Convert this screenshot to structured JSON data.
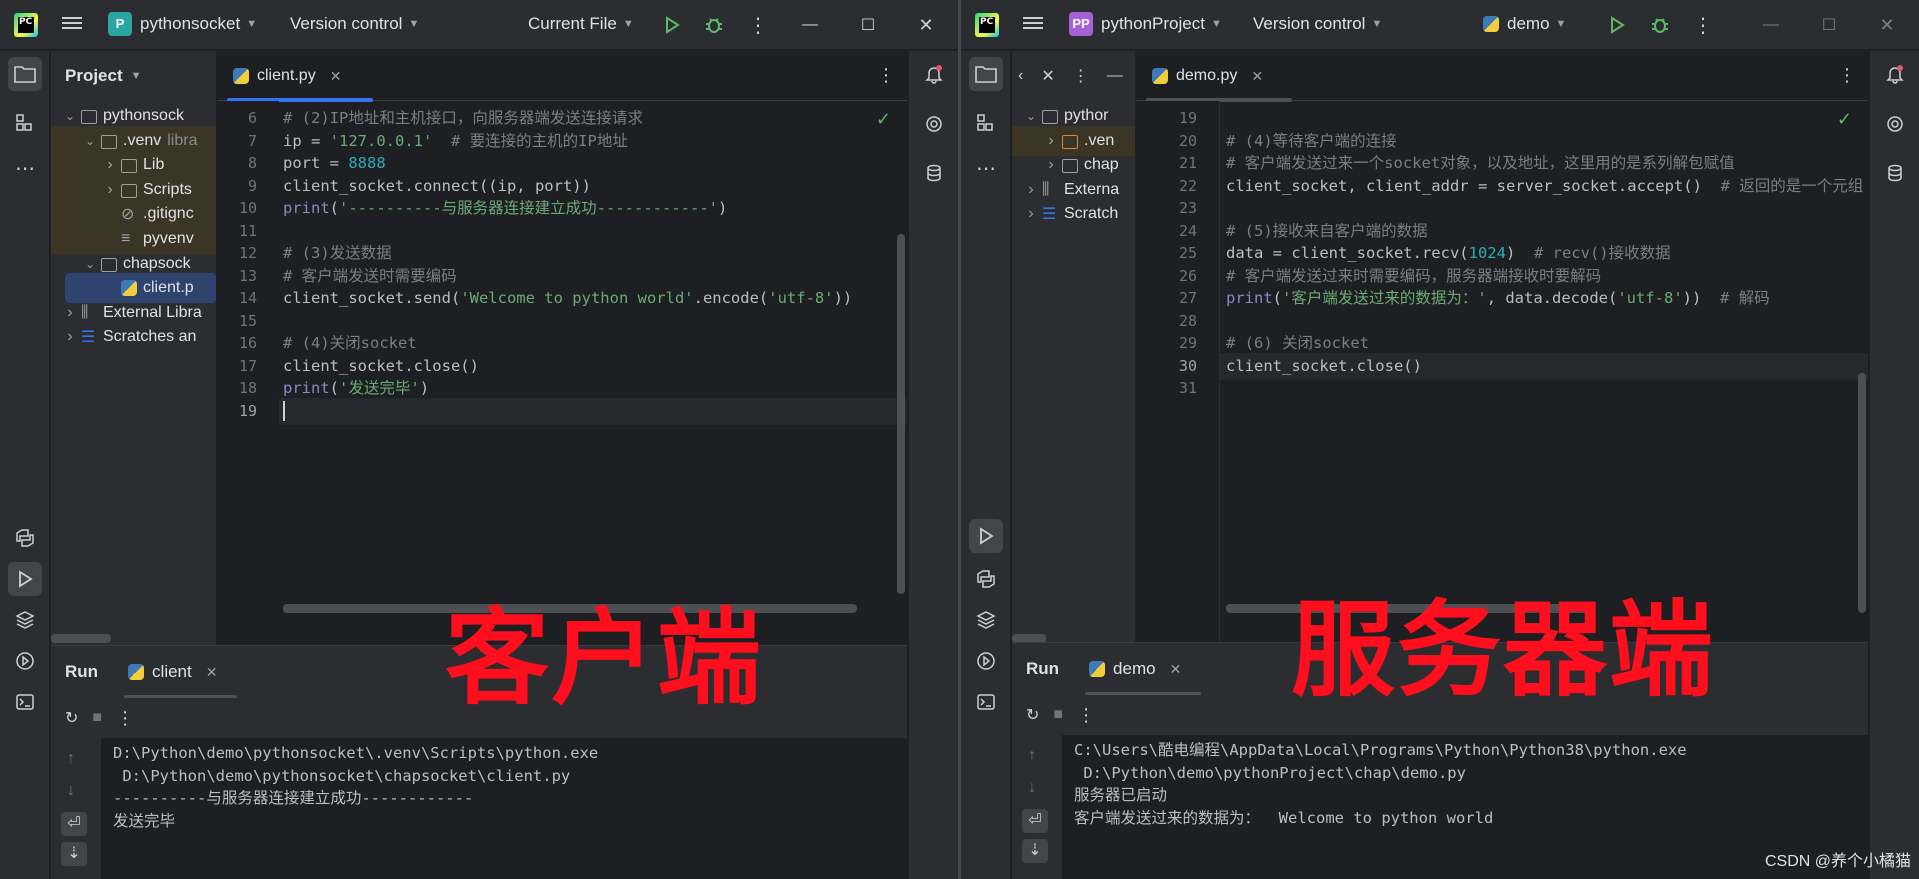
{
  "left": {
    "project_badge": "P",
    "project_name": "pythonsocket",
    "vcs": "Version control",
    "run_config": "Current File",
    "project_panel_title": "Project",
    "tree": [
      {
        "label": "pythonsock",
        "indent": 0,
        "arrow": "down",
        "icon": "folder",
        "style": ""
      },
      {
        "label": ".venv",
        "extra": "libra",
        "indent": 1,
        "arrow": "down",
        "icon": "folder",
        "style": "excl"
      },
      {
        "label": "Lib",
        "indent": 2,
        "arrow": "right",
        "icon": "folder",
        "style": "excl"
      },
      {
        "label": "Scripts",
        "indent": 2,
        "arrow": "right",
        "icon": "folder",
        "style": "excl"
      },
      {
        "label": ".gitignc",
        "indent": 2,
        "arrow": "",
        "icon": "ignore",
        "style": "excl"
      },
      {
        "label": "pyvenv",
        "indent": 2,
        "arrow": "",
        "icon": "text",
        "style": "excl"
      },
      {
        "label": "chapsock",
        "indent": 1,
        "arrow": "down",
        "icon": "folder",
        "style": ""
      },
      {
        "label": "client.p",
        "indent": 2,
        "arrow": "",
        "icon": "python",
        "style": "sel"
      },
      {
        "label": "External Libra",
        "indent": 0,
        "arrow": "right",
        "icon": "library",
        "style": ""
      },
      {
        "label": "Scratches an",
        "indent": 0,
        "arrow": "right",
        "icon": "scratch",
        "style": ""
      }
    ],
    "tab": "client.py",
    "lines": [
      {
        "n": "6",
        "html": "<span class=\"cm\"># (2)IP地址和主机接口，向服务器端发送连接请求</span>"
      },
      {
        "n": "7",
        "html": "ip = <span class=\"st\">'127.0.0.1'</span>  <span class=\"cm\"># 要连接的主机的IP地址</span>"
      },
      {
        "n": "8",
        "html": "port = <span class=\"nu\">8888</span>"
      },
      {
        "n": "9",
        "html": "client_socket.connect((ip, port))"
      },
      {
        "n": "10",
        "html": "<span class=\"kw\">print</span>(<span class=\"st\">'----------与服务器连接建立成功------------'</span>)"
      },
      {
        "n": "11",
        "html": ""
      },
      {
        "n": "12",
        "html": "<span class=\"cm\"># (3)发送数据</span>"
      },
      {
        "n": "13",
        "html": "<span class=\"cm\"># 客户端发送时需要编码</span>"
      },
      {
        "n": "14",
        "html": "client_socket.send(<span class=\"st\">'Welcome to python world'</span>.encode(<span class=\"st\">'utf-8'</span>))"
      },
      {
        "n": "15",
        "html": ""
      },
      {
        "n": "16",
        "html": "<span class=\"cm\"># (4)关闭socket</span>"
      },
      {
        "n": "17",
        "html": "client_socket.close()"
      },
      {
        "n": "18",
        "html": "<span class=\"kw\">print</span>(<span class=\"st\">'发送完毕'</span>)"
      },
      {
        "n": "19",
        "html": "<span class=\"caret\"></span>"
      }
    ],
    "current_line": 13,
    "run_label": "Run",
    "run_tab": "client",
    "output": [
      "D:\\Python\\demo\\pythonsocket\\.venv\\Scripts\\python.exe",
      " D:\\Python\\demo\\pythonsocket\\chapsocket\\client.py",
      "----------与服务器连接建立成功------------",
      "发送完毕"
    ],
    "overlay": "客户端"
  },
  "right": {
    "project_badge": "PP",
    "project_name": "pythonProject",
    "vcs": "Version control",
    "run_config": "demo",
    "tree": [
      {
        "label": "pythor",
        "indent": 0,
        "arrow": "down",
        "icon": "folder",
        "style": ""
      },
      {
        "label": ".ven",
        "indent": 1,
        "arrow": "right",
        "icon": "folder-orange",
        "style": "excl"
      },
      {
        "label": "chap",
        "indent": 1,
        "arrow": "right",
        "icon": "folder",
        "style": ""
      },
      {
        "label": "Externa",
        "indent": 0,
        "arrow": "right",
        "icon": "library",
        "style": ""
      },
      {
        "label": "Scratch",
        "indent": 0,
        "arrow": "right",
        "icon": "scratch",
        "style": ""
      }
    ],
    "tab": "demo.py",
    "lines": [
      {
        "n": "19",
        "html": ""
      },
      {
        "n": "20",
        "html": "<span class=\"cm\"># (4)等待客户端的连接</span>"
      },
      {
        "n": "21",
        "html": "<span class=\"cm\"># 客户端发送过来一个socket对象，以及地址，这里用的是系列解包赋值</span>"
      },
      {
        "n": "22",
        "html": "client_socket, client_addr = server_socket.accept()  <span class=\"cm\"># 返回的是一个元组</span>"
      },
      {
        "n": "23",
        "html": ""
      },
      {
        "n": "24",
        "html": "<span class=\"cm\"># (5)接收来自客户端的数据</span>"
      },
      {
        "n": "25",
        "html": "data = client_socket.recv(<span class=\"nu\">1024</span>)  <span class=\"cm\"># recv()接收数据</span>"
      },
      {
        "n": "26",
        "html": "<span class=\"cm\"># 客户端发送过来时需要编码，服务器端接收时要解码</span>"
      },
      {
        "n": "27",
        "html": "<span class=\"kw\">print</span>(<span class=\"st\">'客户端发送过来的数据为：'</span>, data.decode(<span class=\"st\">'utf-8'</span>))  <span class=\"cm\"># 解码</span>"
      },
      {
        "n": "28",
        "html": ""
      },
      {
        "n": "29",
        "html": "<span class=\"cm\"># (6) 关闭socket</span>"
      },
      {
        "n": "30",
        "html": "client_socket.close()"
      },
      {
        "n": "31",
        "html": ""
      }
    ],
    "current_line": 11,
    "run_label": "Run",
    "run_tab": "demo",
    "output": [
      "C:\\Users\\酷电编程\\AppData\\Local\\Programs\\Python\\Python38\\python.exe",
      " D:\\Python\\demo\\pythonProject\\chap\\demo.py",
      "服务器已启动",
      "客户端发送过来的数据为：  Welcome to python world"
    ],
    "overlay": "服务器端"
  },
  "watermark": "CSDN @养个小橘猫",
  "colors": {
    "accent": "#3574f0",
    "overlay_red": "#ff0e1e",
    "run_green": "#5fb865",
    "debug_green": "#5fb865"
  }
}
